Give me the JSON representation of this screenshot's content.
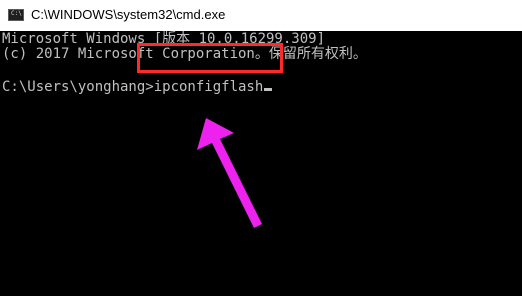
{
  "window": {
    "title": "C:\\WINDOWS\\system32\\cmd.exe",
    "icon": "cmd-icon"
  },
  "console": {
    "line1": "Microsoft Windows [版本 10.0.16299.309]",
    "line2": "(c) 2017 Microsoft Corporation。保留所有权利。",
    "prompt": "C:\\Users\\yonghang>",
    "command": "ipconfigflash"
  },
  "annotation": {
    "box_color": "#ff2a2a",
    "arrow_color": "#ee22ee"
  }
}
